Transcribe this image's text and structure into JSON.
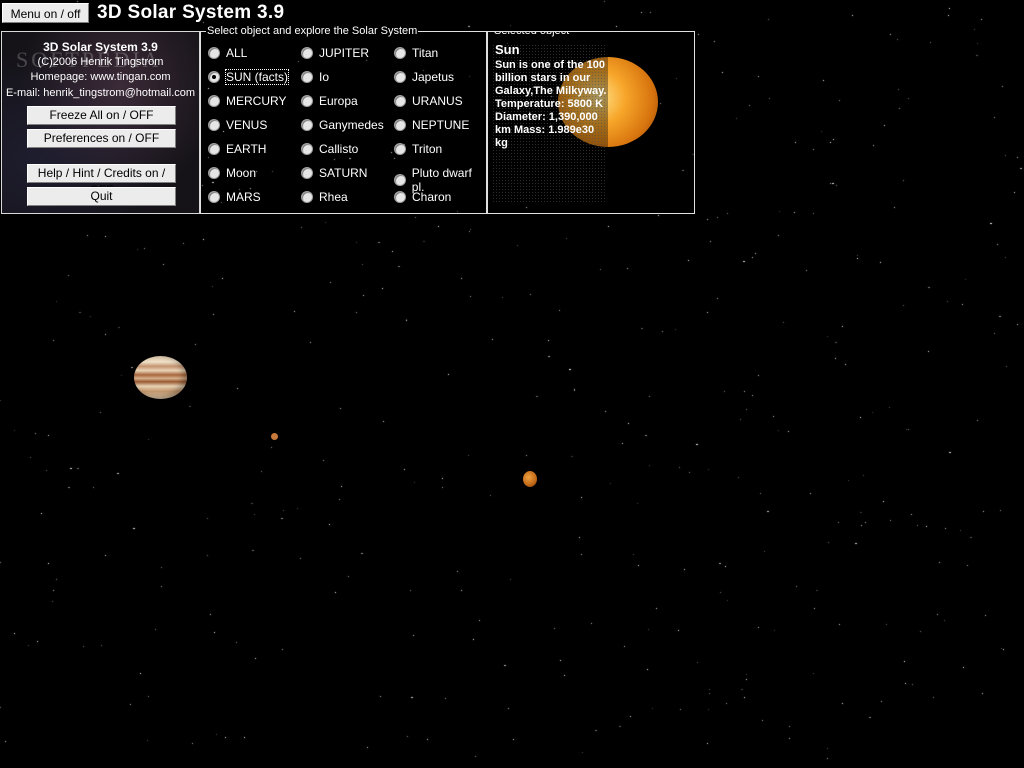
{
  "toolbar": {
    "menu_button": "Menu on / off",
    "app_title": "3D Solar System 3.9"
  },
  "info_panel": {
    "watermark": "SOFTPEDIA",
    "title": "3D Solar System 3.9",
    "copyright": "(C)2006 Henrik Tingstrom",
    "homepage": "Homepage: www.tingan.com",
    "email": "E-mail: henrik_tingstrom@hotmail.com",
    "buttons": {
      "freeze": "Freeze All on / OFF",
      "preferences": "Preferences on / OFF",
      "help": "Help / Hint / Credits on / OFF",
      "quit": "Quit"
    }
  },
  "select_group": {
    "label": "Select object and explore the Solar System",
    "selected": "SUN (facts)",
    "columns": [
      [
        "ALL",
        "SUN (facts)",
        "MERCURY",
        "VENUS",
        "EARTH",
        "Moon",
        "MARS"
      ],
      [
        "JUPITER",
        "Io",
        "Europa",
        "Ganymedes",
        "Callisto",
        "SATURN",
        "Rhea"
      ],
      [
        "Titan",
        "Japetus",
        "URANUS",
        "NEPTUNE",
        "Triton",
        "Pluto dwarf pl.",
        "Charon"
      ]
    ]
  },
  "selected_object": {
    "label": "Selected object",
    "name": "Sun",
    "facts": "Sun is one of the 100 billion stars in our Galaxy,The Milkyway. Temperature: 5800 K Diameter: 1,390,000 km Mass: 1.989e30 kg"
  },
  "scene": {
    "bodies": [
      "jupiter",
      "io",
      "europa"
    ]
  }
}
